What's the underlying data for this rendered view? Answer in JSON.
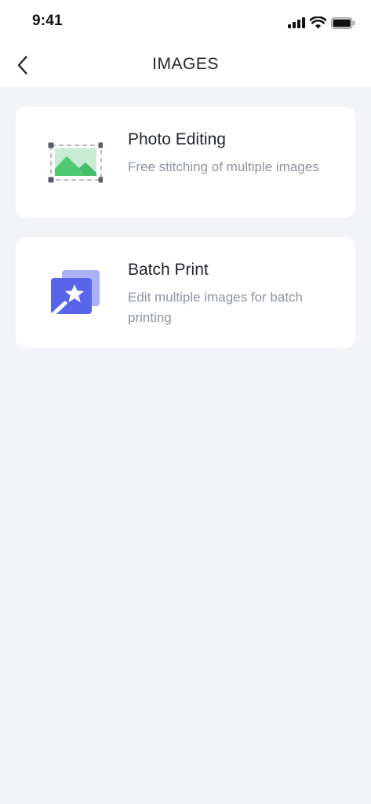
{
  "status_bar": {
    "time": "9:41",
    "icons": [
      "signal-icon",
      "wifi-icon",
      "battery-icon"
    ]
  },
  "header": {
    "title": "IMAGES",
    "back_icon": "chevron-left-icon"
  },
  "options": [
    {
      "title": "Photo Editing",
      "description": "Free stitching of multiple images",
      "icon": "photo-crop-icon",
      "icon_colors": [
        "#4fc971",
        "#c9ebd1"
      ]
    },
    {
      "title": "Batch Print",
      "description": "Edit multiple images for batch printing",
      "icon": "batch-images-icon",
      "icon_colors": [
        "#5865e8",
        "#aab2f5"
      ]
    }
  ],
  "colors": {
    "background": "#f3f4f8",
    "card": "#ffffff",
    "title_text": "#23262f",
    "secondary_text": "#8e93a4"
  }
}
